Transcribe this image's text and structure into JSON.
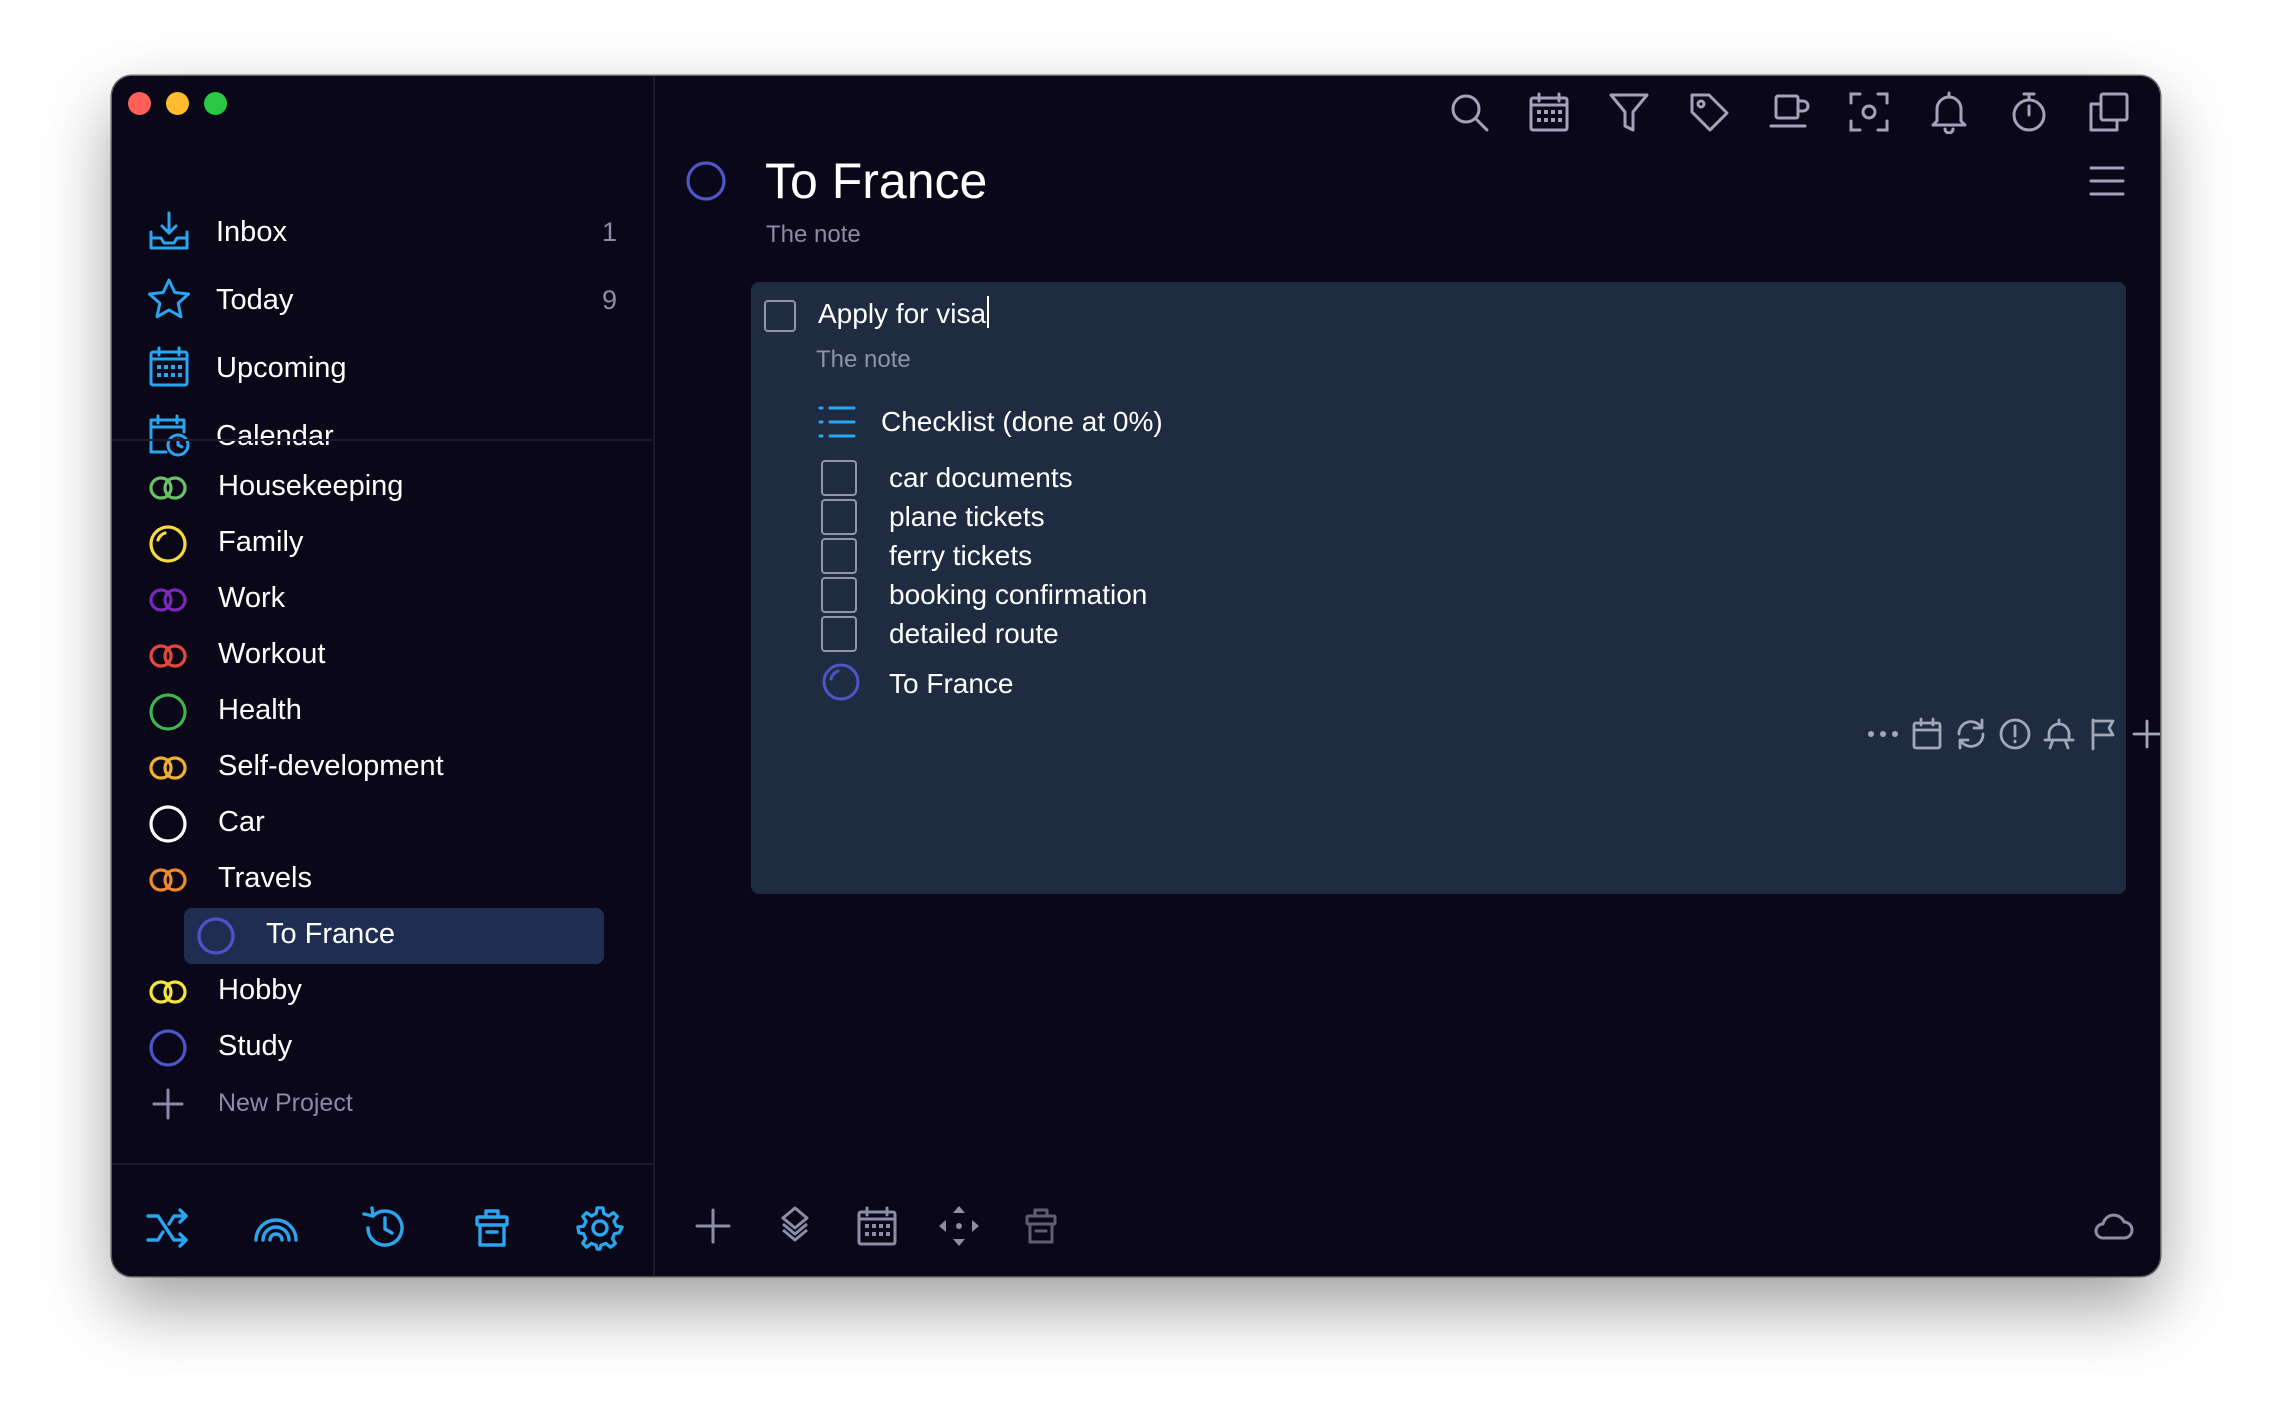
{
  "colors": {
    "window_bg": "#0a0719",
    "accent_blue": "#2aa5f0",
    "selected_bg": "#1f2d52",
    "card_bg": "#1e2b41",
    "muted_text": "#8d8ba5"
  },
  "sidebar": {
    "nav": [
      {
        "label": "Inbox",
        "count": "1",
        "icon": "inbox-tray-icon"
      },
      {
        "label": "Today",
        "count": "9",
        "icon": "star-icon"
      },
      {
        "label": "Upcoming",
        "count": "",
        "icon": "calendar-grid-icon"
      },
      {
        "label": "Calendar",
        "count": "",
        "icon": "calendar-clock-icon"
      }
    ],
    "projects": [
      {
        "label": "Housekeeping",
        "color": "#6cc06a",
        "icon": "double-ring-icon"
      },
      {
        "label": "Family",
        "color": "#f6dd3c",
        "icon": "progress-ring-icon"
      },
      {
        "label": "Work",
        "color": "#7a2ab8",
        "icon": "double-ring-icon"
      },
      {
        "label": "Workout",
        "color": "#e8473d",
        "icon": "double-ring-icon"
      },
      {
        "label": "Health",
        "color": "#3fb34f",
        "icon": "ring-icon"
      },
      {
        "label": "Self-development",
        "color": "#f3b02f",
        "icon": "double-ring-icon"
      },
      {
        "label": "Car",
        "color": "#ffffff",
        "icon": "ring-icon"
      },
      {
        "label": "Travels",
        "color": "#f08a2a",
        "icon": "double-ring-icon"
      },
      {
        "label": "To France",
        "color": "#4e55c9",
        "icon": "ring-icon",
        "selected": true,
        "sub": true
      },
      {
        "label": "Hobby",
        "color": "#f6e43a",
        "icon": "double-ring-icon"
      },
      {
        "label": "Study",
        "color": "#4e55c9",
        "icon": "ring-icon"
      }
    ],
    "new_project_label": "New Project",
    "bottom_icons": [
      "shuffle-icon",
      "rainbow-icon",
      "history-icon",
      "trash-icon",
      "gear-icon"
    ]
  },
  "toolbar": {
    "icons": [
      "search-icon",
      "calendar-icon",
      "filter-icon",
      "tag-icon",
      "coffee-icon",
      "focus-icon",
      "bell-icon",
      "timer-icon",
      "copy-icon"
    ]
  },
  "project": {
    "title": "To France",
    "note": "The note"
  },
  "task": {
    "title": "Apply for visa",
    "note": "The note",
    "checklist_title": "Checklist (done at 0%)",
    "checklist": [
      "car documents",
      "plane tickets",
      "ferry tickets",
      "booking confirmation",
      "detailed route"
    ],
    "project_label": "To France",
    "tools": [
      "more-icon",
      "calendar-icon",
      "repeat-icon",
      "priority-icon",
      "reminder-icon",
      "flag-icon",
      "add-icon",
      "tag-icon"
    ]
  },
  "main_bottom": {
    "icons": [
      "add-icon",
      "diamond-stack-icon",
      "calendar-icon",
      "move-icon",
      "trash-icon",
      "cloud-icon"
    ]
  }
}
